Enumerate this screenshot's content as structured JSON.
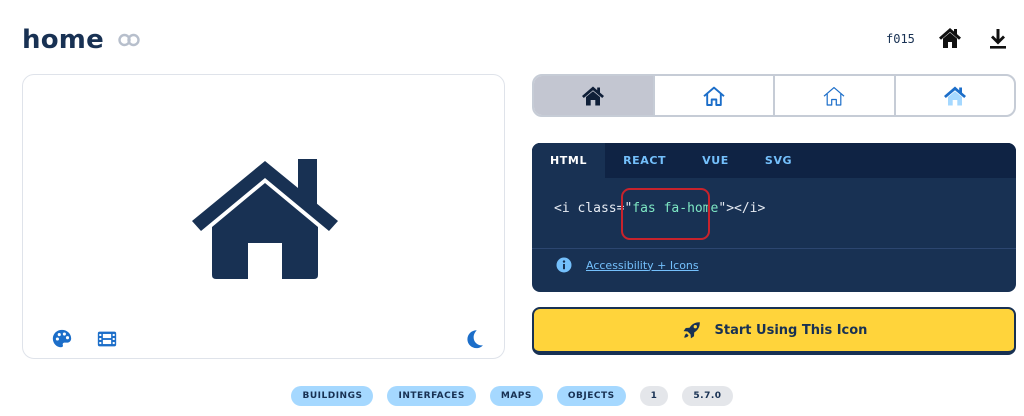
{
  "header": {
    "title": "home",
    "unicode": "f015"
  },
  "styles": {
    "items": [
      "solid",
      "regular",
      "light",
      "duotone"
    ],
    "active": "solid"
  },
  "code": {
    "tabs": [
      "HTML",
      "REACT",
      "VUE",
      "SVG"
    ],
    "active_tab": "HTML",
    "prefix": "<i class=\"",
    "class_value": "fas fa-home",
    "suffix": "\"></i>",
    "accessibility_link": "Accessibility + Icons"
  },
  "cta": {
    "label": "Start Using This Icon"
  },
  "tags": {
    "categories": [
      "BUILDINGS",
      "INTERFACES",
      "MAPS",
      "OBJECTS"
    ],
    "count": "1",
    "version": "5.7.0"
  },
  "colors": {
    "navy": "#183153",
    "accent_blue": "#74c0fc",
    "cta_yellow": "#ffd43b",
    "highlight_red": "#c8232c",
    "tag_blue": "#a5d8ff"
  },
  "icons": {
    "header_link": "link-icon",
    "header_home": "home-icon",
    "header_download": "download-icon",
    "preview_tools": [
      "palette-icon",
      "film-icon",
      "moon-icon"
    ],
    "info": "info-circle-icon",
    "cta": "rocket-icon"
  }
}
